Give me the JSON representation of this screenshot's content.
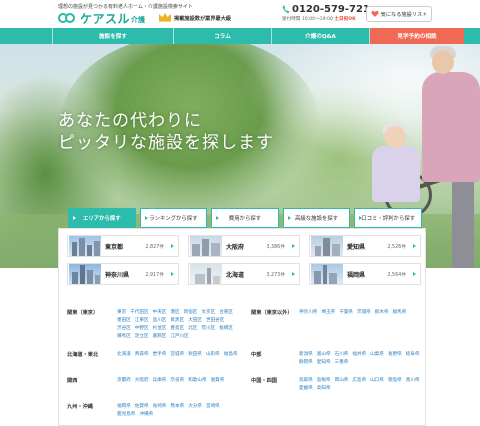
{
  "header": {
    "tagline": "理想の施設が見つかる有料老人ホーム・介護施設検索サイト",
    "logo_text": "ケアスル",
    "logo_sub": "介護",
    "rank_text": "掲載施設数が業界最大級",
    "phone_number": "0120-579-721",
    "phone_hours": "受付時間 10:00～19:00",
    "phone_ok": "土日祝OK",
    "favorite_label": "気になる施設リスト"
  },
  "nav": {
    "items": [
      "施設を探す",
      "コラム",
      "介護のQ&A",
      "見学予約の相談"
    ]
  },
  "hero": {
    "line1": "あなたの代わりに",
    "line2": "ピッタリな施設を探します"
  },
  "tabs": [
    "エリアから探す",
    "ランキングから探す",
    "費用から探す",
    "高級な施設を探す",
    "口コミ・評判から探す"
  ],
  "prefectures": [
    {
      "name": "東京都",
      "count": "2,827件"
    },
    {
      "name": "大阪府",
      "count": "3,386件"
    },
    {
      "name": "愛知県",
      "count": "2,526件"
    },
    {
      "name": "神奈川県",
      "count": "2,917件"
    },
    {
      "name": "北海道",
      "count": "3,273件"
    },
    {
      "name": "福岡県",
      "count": "2,564件"
    }
  ],
  "regions": [
    {
      "name": "関東（東京）",
      "cities": [
        "東京",
        "千代田区",
        "中央区",
        "港区",
        "新宿区",
        "文京区",
        "台東区",
        "墨田区",
        "江東区",
        "品川区",
        "目黒区",
        "大田区",
        "世田谷区",
        "渋谷区",
        "中野区",
        "杉並区",
        "豊島区",
        "北区",
        "荒川区",
        "板橋区",
        "練馬区",
        "足立区",
        "葛飾区",
        "江戸川区"
      ]
    },
    {
      "name": "関東（東京以外）",
      "cities": [
        "神奈川県",
        "埼玉県",
        "千葉県",
        "茨城県",
        "栃木県",
        "群馬県"
      ]
    },
    {
      "name": "北海道・東北",
      "cities": [
        "北海道",
        "青森県",
        "岩手県",
        "宮城県",
        "秋田県",
        "山形県",
        "福島県"
      ]
    },
    {
      "name": "中部",
      "cities": [
        "新潟県",
        "富山県",
        "石川県",
        "福井県",
        "山梨県",
        "長野県",
        "岐阜県",
        "静岡県",
        "愛知県",
        "三重県"
      ]
    },
    {
      "name": "関西",
      "cities": [
        "京都府",
        "大阪府",
        "兵庫県",
        "奈良県",
        "和歌山県",
        "滋賀県"
      ]
    },
    {
      "name": "中国・四国",
      "cities": [
        "鳥取県",
        "島根県",
        "岡山県",
        "広島県",
        "山口県",
        "徳島県",
        "香川県",
        "愛媛県",
        "高知県"
      ]
    },
    {
      "name": "九州・沖縄",
      "cities": [
        "福岡県",
        "佐賀県",
        "長崎県",
        "熊本県",
        "大分県",
        "宮崎県",
        "鹿児島県",
        "沖縄県"
      ]
    }
  ],
  "colors": {
    "brand": "#2dbcab",
    "cta": "#ef6a55",
    "link": "#2a7fc0"
  }
}
